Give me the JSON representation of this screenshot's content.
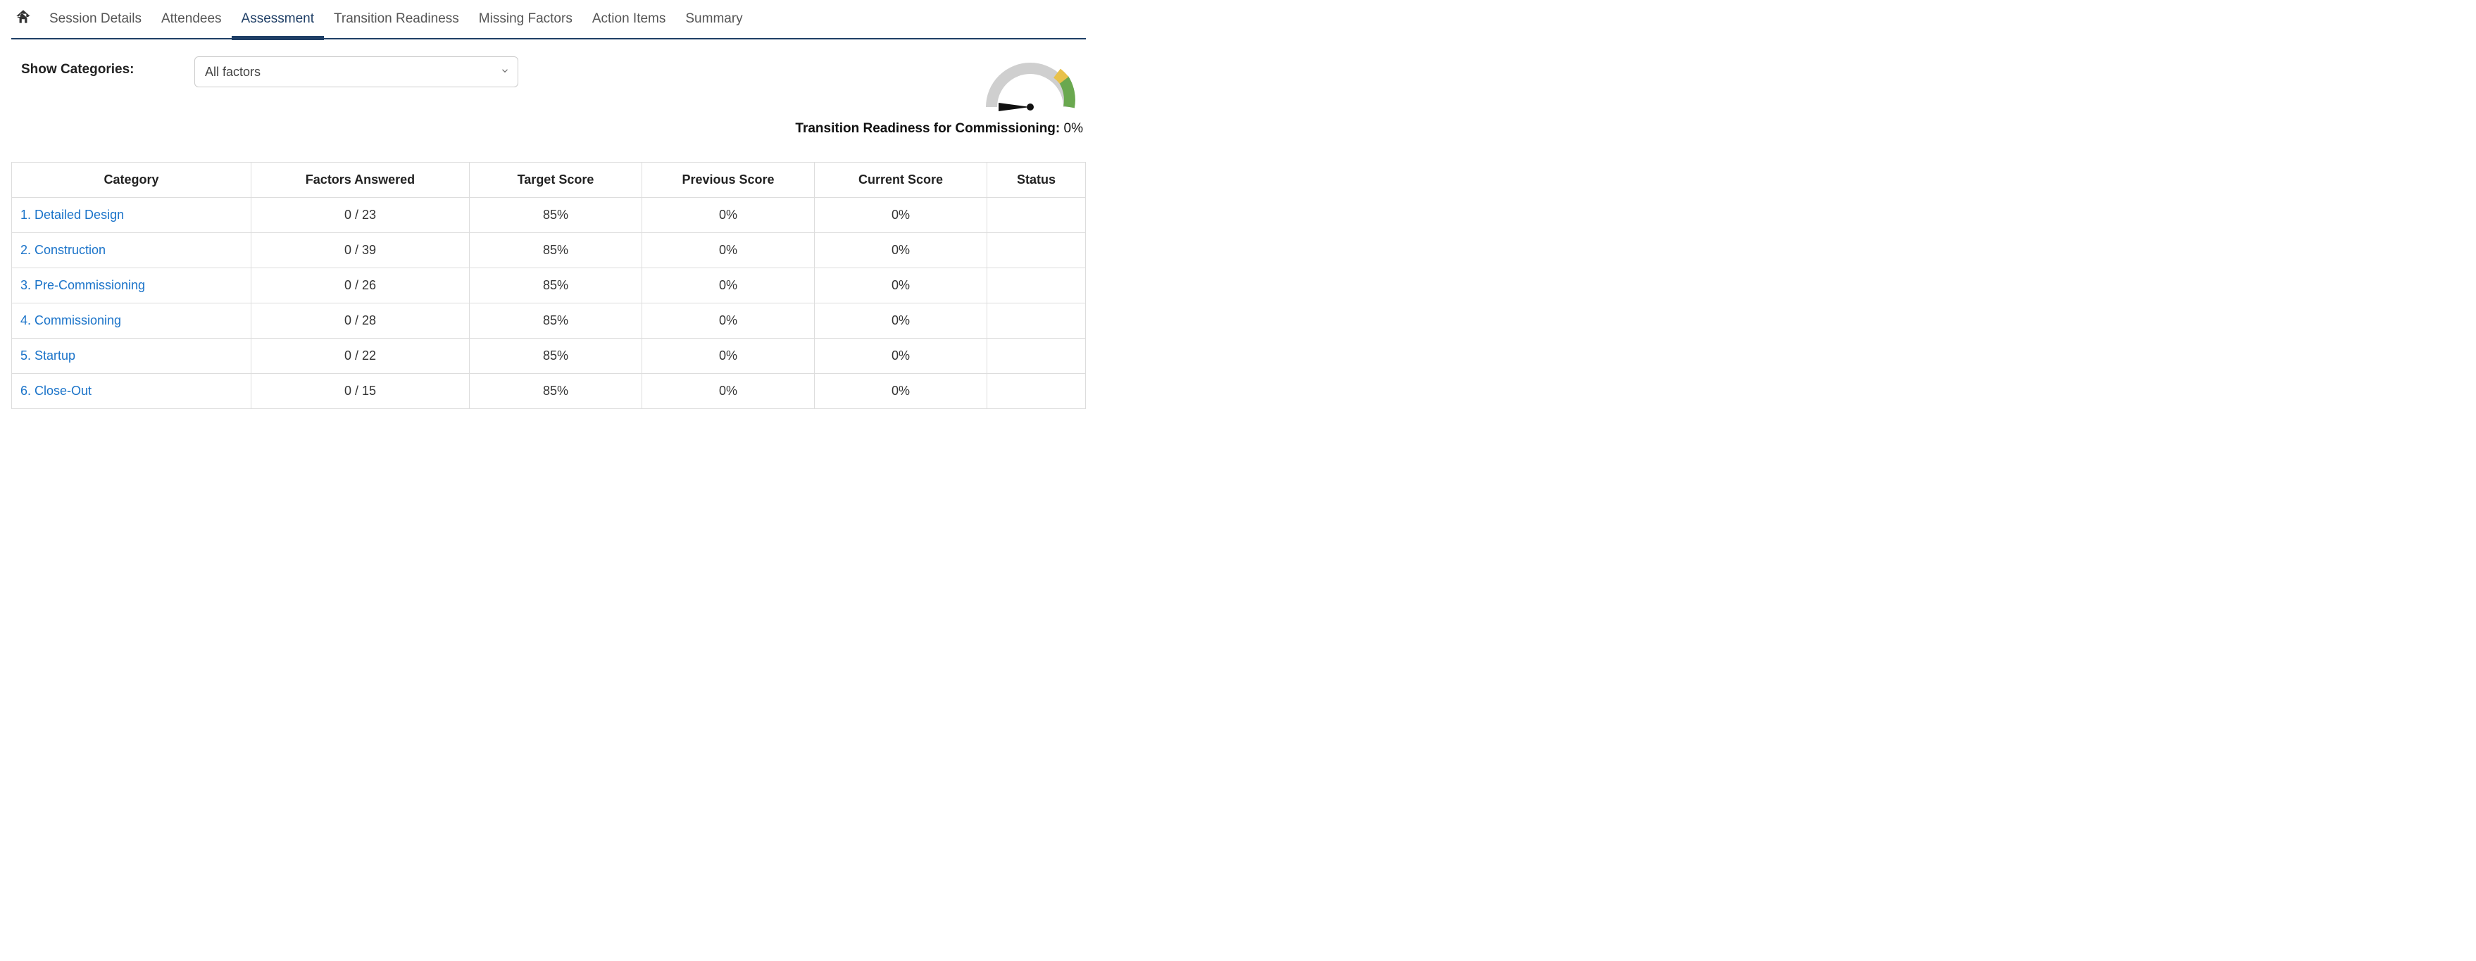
{
  "nav": {
    "tabs": [
      {
        "label": "Session Details"
      },
      {
        "label": "Attendees"
      },
      {
        "label": "Assessment",
        "active": true
      },
      {
        "label": "Transition Readiness"
      },
      {
        "label": "Missing Factors"
      },
      {
        "label": "Action Items"
      },
      {
        "label": "Summary"
      }
    ]
  },
  "filter": {
    "label": "Show Categories:",
    "selected": "All factors"
  },
  "readiness": {
    "label": "Transition Readiness for Commissioning:",
    "value": "0%"
  },
  "table": {
    "headers": {
      "category": "Category",
      "factors_answered": "Factors Answered",
      "target_score": "Target Score",
      "previous_score": "Previous Score",
      "current_score": "Current Score",
      "status": "Status"
    },
    "rows": [
      {
        "category": "1. Detailed Design",
        "factors_answered": "0 / 23",
        "target_score": "85%",
        "previous_score": "0%",
        "current_score": "0%",
        "status": ""
      },
      {
        "category": "2. Construction",
        "factors_answered": "0 / 39",
        "target_score": "85%",
        "previous_score": "0%",
        "current_score": "0%",
        "status": ""
      },
      {
        "category": "3. Pre-Commissioning",
        "factors_answered": "0 / 26",
        "target_score": "85%",
        "previous_score": "0%",
        "current_score": "0%",
        "status": ""
      },
      {
        "category": "4. Commissioning",
        "factors_answered": "0 / 28",
        "target_score": "85%",
        "previous_score": "0%",
        "current_score": "0%",
        "status": ""
      },
      {
        "category": "5. Startup",
        "factors_answered": "0 / 22",
        "target_score": "85%",
        "previous_score": "0%",
        "current_score": "0%",
        "status": ""
      },
      {
        "category": "6. Close-Out",
        "factors_answered": "0 / 15",
        "target_score": "85%",
        "previous_score": "0%",
        "current_score": "0%",
        "status": ""
      }
    ]
  }
}
